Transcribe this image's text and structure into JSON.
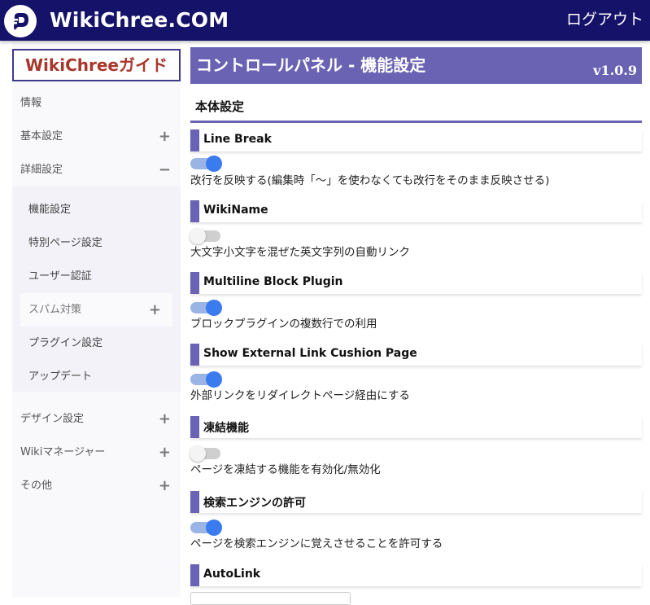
{
  "header": {
    "site_title": "WikiChree.COM",
    "logout_label": "ログアウト",
    "logo_icon": "wikichree-logo-icon",
    "bar_color": "#15126a"
  },
  "sidebar": {
    "guide_title": "WikiChreeガイド",
    "items": [
      {
        "label": "情報"
      },
      {
        "label": "基本設定",
        "sign": "+"
      },
      {
        "label": "詳細設定",
        "sign": "−"
      }
    ],
    "sub_items": [
      {
        "label": "機能設定"
      },
      {
        "label": "特別ページ設定"
      },
      {
        "label": "ユーザー認証"
      },
      {
        "label": "スパム対策",
        "sign": "+"
      },
      {
        "label": "プラグイン設定"
      },
      {
        "label": "アップデート"
      }
    ],
    "bottom_items": [
      {
        "label": "デザイン設定",
        "sign": "+"
      },
      {
        "label": "Wikiマネージャー",
        "sign": "+"
      },
      {
        "label": "その他",
        "sign": "+"
      }
    ]
  },
  "main": {
    "panel_title": "コントロールパネル - 機能設定",
    "version": "v1.0.9",
    "section_title": "本体設定",
    "accent_color": "#6a63b3",
    "settings": [
      {
        "name": "Line Break",
        "enabled": true,
        "description": "改行を反映する(編集時「～」を使わなくても改行をそのまま反映させる)"
      },
      {
        "name": "WikiName",
        "enabled": false,
        "description": "大文字小文字を混ぜた英文字列の自動リンク"
      },
      {
        "name": "Multiline Block Plugin",
        "enabled": true,
        "description": "ブロックプラグインの複数行での利用"
      },
      {
        "name": "Show External Link Cushion Page",
        "enabled": true,
        "description": "外部リンクをリダイレクトページ経由にする"
      },
      {
        "name": "凍結機能",
        "enabled": false,
        "description": "ページを凍結する機能を有効化/無効化"
      },
      {
        "name": "検索エンジンの許可",
        "enabled": true,
        "description": "ページを検索エンジンに覚えさせることを許可する"
      },
      {
        "name": "AutoLink"
      }
    ]
  }
}
